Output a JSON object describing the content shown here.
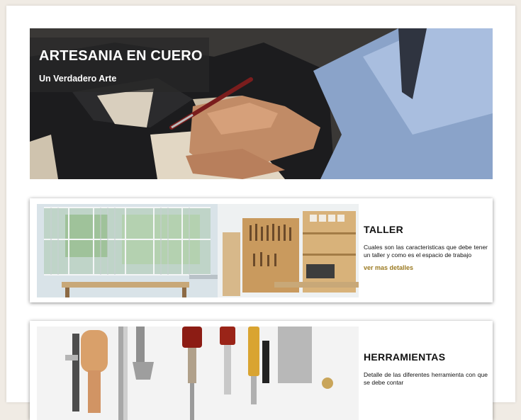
{
  "hero": {
    "title": "ARTESANIA EN CUERO",
    "subtitle": "Un Verdadero Arte"
  },
  "cards": [
    {
      "title": "TALLER",
      "description": "Cuales son las caracteristicas que debe tener un taller y como es el espacio de trabajo",
      "link": "ver mas detalles"
    },
    {
      "title": "HERRAMIENTAS",
      "description": "Detalle de las diferentes herramienta con que se debe contar"
    }
  ],
  "colors": {
    "link": "#9b7a22",
    "overlay": "#282828"
  }
}
